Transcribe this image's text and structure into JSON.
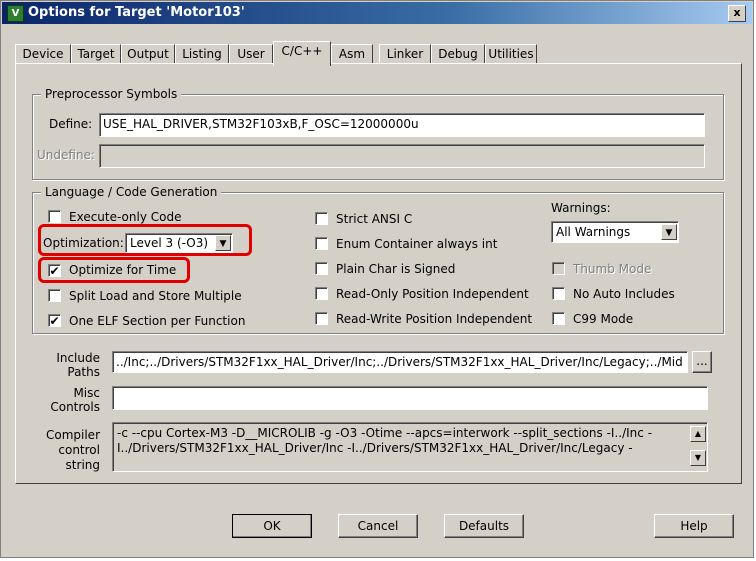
{
  "window": {
    "title": "Options for Target 'Motor103'",
    "close_glyph": "x",
    "icon_glyph": "V"
  },
  "tabs": [
    "Device",
    "Target",
    "Output",
    "Listing",
    "User",
    "C/C++",
    "Asm",
    "Linker",
    "Debug",
    "Utilities"
  ],
  "active_tab": "C/C++",
  "preprocessor": {
    "legend": "Preprocessor Symbols",
    "define_label": "Define:",
    "define_value": "USE_HAL_DRIVER,STM32F103xB,F_OSC=12000000u",
    "undefine_label": "Undefine:",
    "undefine_value": ""
  },
  "language": {
    "legend": "Language / Code Generation",
    "execute_only": {
      "label": "Execute-only Code",
      "checked": false
    },
    "optimization_label": "Optimization:",
    "optimization_value": "Level 3 (-O3)",
    "optimize_time": {
      "label": "Optimize for Time",
      "checked": true
    },
    "split_load": {
      "label": "Split Load and Store Multiple",
      "checked": false
    },
    "one_elf": {
      "label": "One ELF Section per Function",
      "checked": true
    },
    "strict_ansi": {
      "label": "Strict ANSI C",
      "checked": false
    },
    "enum_container": {
      "label": "Enum Container always int",
      "checked": false
    },
    "plain_char": {
      "label": "Plain Char is Signed",
      "checked": false
    },
    "ro_pi": {
      "label": "Read-Only Position Independent",
      "checked": false
    },
    "rw_pi": {
      "label": "Read-Write Position Independent",
      "checked": false
    },
    "warnings_label": "Warnings:",
    "warnings_value": "All Warnings",
    "thumb_mode": {
      "label": "Thumb Mode",
      "checked": false,
      "disabled": true
    },
    "no_auto_includes": {
      "label": "No Auto Includes",
      "checked": false
    },
    "c99_mode": {
      "label": "C99 Mode",
      "checked": false
    }
  },
  "include_paths": {
    "label": "Include Paths",
    "value": "../Inc;../Drivers/STM32F1xx_HAL_Driver/Inc;../Drivers/STM32F1xx_HAL_Driver/Inc/Legacy;../Mid",
    "browse_label": "..."
  },
  "misc_controls": {
    "label": "Misc Controls",
    "value": ""
  },
  "compiler_control": {
    "label": "Compiler control string",
    "line1": "-c --cpu Cortex-M3 -D__MICROLIB -g -O3 -Otime --apcs=interwork --split_sections -I../Inc -",
    "line2": "I../Drivers/STM32F1xx_HAL_Driver/Inc -I../Drivers/STM32F1xx_HAL_Driver/Inc/Legacy -"
  },
  "buttons": {
    "ok": "OK",
    "cancel": "Cancel",
    "defaults": "Defaults",
    "help": "Help"
  },
  "icons": {
    "dropdown": "dropdown-arrow-icon",
    "scroll_up": "scroll-up-icon",
    "scroll_down": "scroll-down-icon"
  },
  "check_glyph": "✔",
  "highlight_color": "#e00000"
}
